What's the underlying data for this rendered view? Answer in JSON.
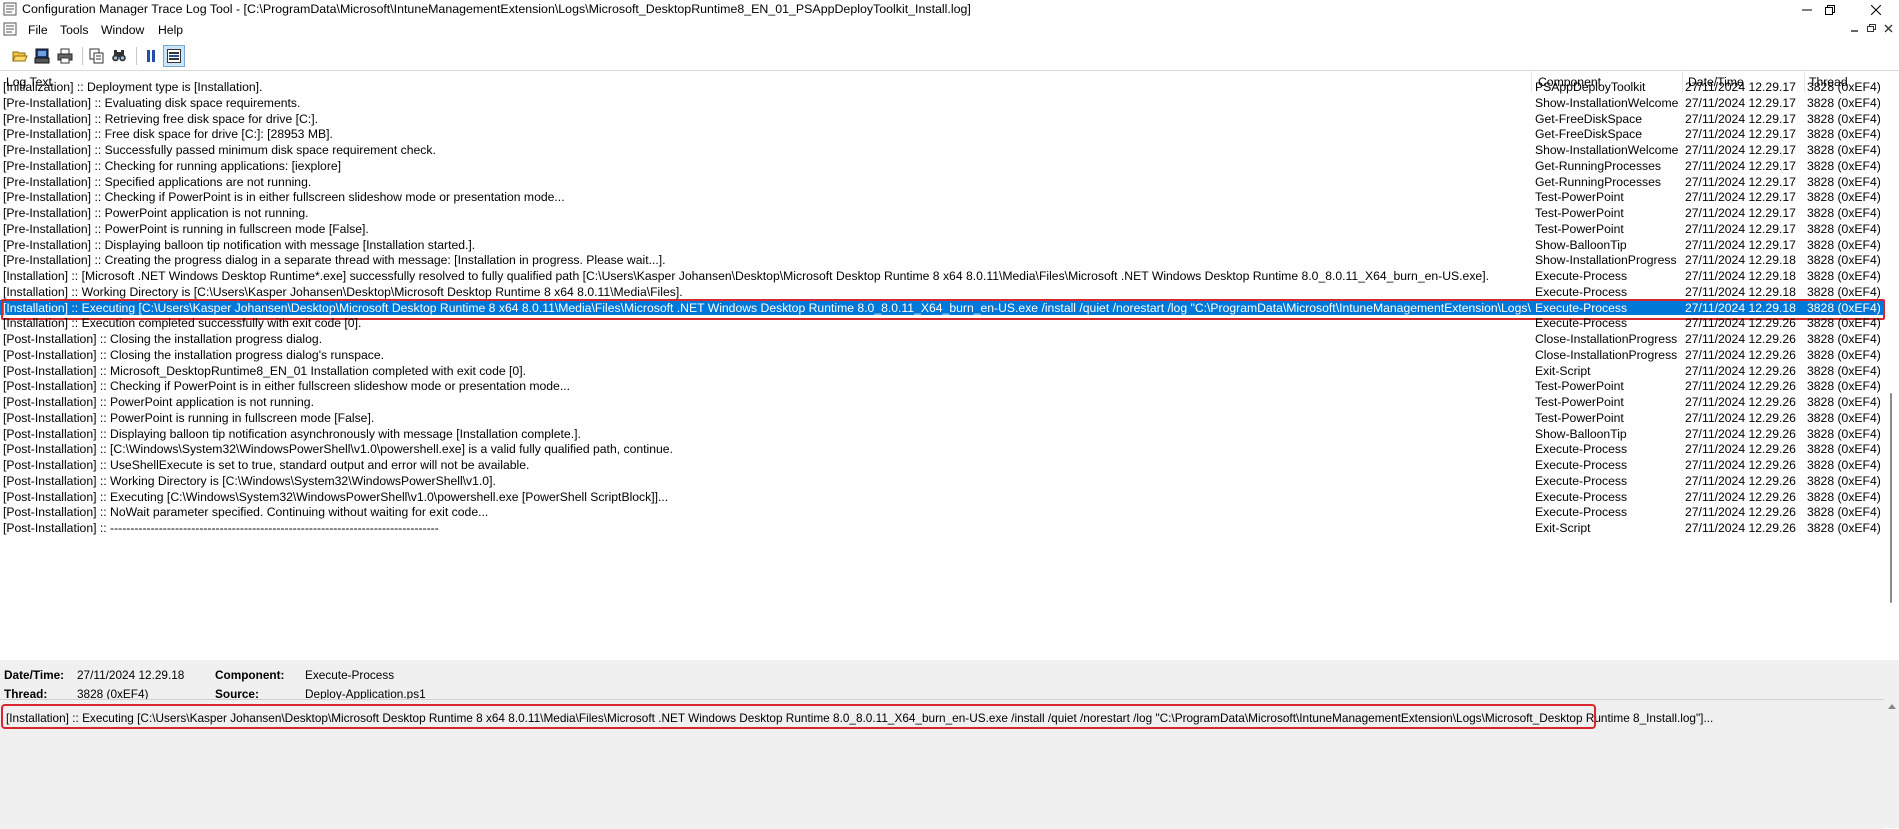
{
  "window": {
    "title": "Configuration Manager Trace Log Tool - [C:\\ProgramData\\Microsoft\\IntuneManagementExtension\\Logs\\Microsoft_DesktopRuntime8_EN_01_PSAppDeployToolkit_Install.log]"
  },
  "menu": {
    "items": [
      "File",
      "Tools",
      "Window",
      "Help"
    ]
  },
  "toolbar": {
    "buttons": [
      "open-icon",
      "print-preview-icon",
      "print-icon",
      "copy-icon",
      "find-icon",
      "pause-icon",
      "highlight-icon"
    ]
  },
  "log": {
    "headers": {
      "text": "Log Text",
      "component": "Component",
      "datetime": "Date/Time",
      "thread": "Thread"
    },
    "selected_index": 14,
    "selection_color": "#0078d7",
    "highlight_color": "#d8262e",
    "rows": [
      {
        "text": "[Initialization] :: Deployment type is [Installation].",
        "component": "PSAppDeployToolkit",
        "datetime": "27/11/2024 12.29.17",
        "thread": "3828 (0xEF4)"
      },
      {
        "text": "[Pre-Installation] :: Evaluating disk space requirements.",
        "component": "Show-InstallationWelcome",
        "datetime": "27/11/2024 12.29.17",
        "thread": "3828 (0xEF4)"
      },
      {
        "text": "[Pre-Installation] :: Retrieving free disk space for drive [C:].",
        "component": "Get-FreeDiskSpace",
        "datetime": "27/11/2024 12.29.17",
        "thread": "3828 (0xEF4)"
      },
      {
        "text": "[Pre-Installation] :: Free disk space for drive [C:]: [28953 MB].",
        "component": "Get-FreeDiskSpace",
        "datetime": "27/11/2024 12.29.17",
        "thread": "3828 (0xEF4)"
      },
      {
        "text": "[Pre-Installation] :: Successfully passed minimum disk space requirement check.",
        "component": "Show-InstallationWelcome",
        "datetime": "27/11/2024 12.29.17",
        "thread": "3828 (0xEF4)"
      },
      {
        "text": "[Pre-Installation] :: Checking for running applications: [iexplore]",
        "component": "Get-RunningProcesses",
        "datetime": "27/11/2024 12.29.17",
        "thread": "3828 (0xEF4)"
      },
      {
        "text": "[Pre-Installation] :: Specified applications are not running.",
        "component": "Get-RunningProcesses",
        "datetime": "27/11/2024 12.29.17",
        "thread": "3828 (0xEF4)"
      },
      {
        "text": "[Pre-Installation] :: Checking if PowerPoint is in either fullscreen slideshow mode or presentation mode...",
        "component": "Test-PowerPoint",
        "datetime": "27/11/2024 12.29.17",
        "thread": "3828 (0xEF4)"
      },
      {
        "text": "[Pre-Installation] :: PowerPoint application is not running.",
        "component": "Test-PowerPoint",
        "datetime": "27/11/2024 12.29.17",
        "thread": "3828 (0xEF4)"
      },
      {
        "text": "[Pre-Installation] :: PowerPoint is running in fullscreen mode [False].",
        "component": "Test-PowerPoint",
        "datetime": "27/11/2024 12.29.17",
        "thread": "3828 (0xEF4)"
      },
      {
        "text": "[Pre-Installation] :: Displaying balloon tip notification with message [Installation started.].",
        "component": "Show-BalloonTip",
        "datetime": "27/11/2024 12.29.17",
        "thread": "3828 (0xEF4)"
      },
      {
        "text": "[Pre-Installation] :: Creating the progress dialog in a separate thread with message: [Installation in progress. Please wait...].",
        "component": "Show-InstallationProgress",
        "datetime": "27/11/2024 12.29.18",
        "thread": "3828 (0xEF4)"
      },
      {
        "text": "[Installation] :: [Microsoft .NET Windows Desktop Runtime*.exe] successfully resolved to fully qualified path [C:\\Users\\Kasper Johansen\\Desktop\\Microsoft Desktop Runtime 8 x64 8.0.11\\Media\\Files\\Microsoft .NET Windows Desktop Runtime 8.0_8.0.11_X64_burn_en-US.exe].",
        "component": "Execute-Process",
        "datetime": "27/11/2024 12.29.18",
        "thread": "3828 (0xEF4)"
      },
      {
        "text": "[Installation] :: Working Directory is [C:\\Users\\Kasper Johansen\\Desktop\\Microsoft Desktop Runtime 8 x64 8.0.11\\Media\\Files].",
        "component": "Execute-Process",
        "datetime": "27/11/2024 12.29.18",
        "thread": "3828 (0xEF4)"
      },
      {
        "text": "[Installation] :: Executing [C:\\Users\\Kasper Johansen\\Desktop\\Microsoft Desktop Runtime 8 x64 8.0.11\\Media\\Files\\Microsoft .NET Windows Desktop Runtime 8.0_8.0.11_X64_burn_en-US.exe /install /quiet /norestart /log \"C:\\ProgramData\\Microsoft\\IntuneManagementExtension\\Logs\\Micr...",
        "component": "Execute-Process",
        "datetime": "27/11/2024 12.29.18",
        "thread": "3828 (0xEF4)"
      },
      {
        "text": "[Installation] :: Execution completed successfully with exit code [0].",
        "component": "Execute-Process",
        "datetime": "27/11/2024 12.29.26",
        "thread": "3828 (0xEF4)"
      },
      {
        "text": "[Post-Installation] :: Closing the installation progress dialog.",
        "component": "Close-InstallationProgress",
        "datetime": "27/11/2024 12.29.26",
        "thread": "3828 (0xEF4)"
      },
      {
        "text": "[Post-Installation] :: Closing the installation progress dialog's runspace.",
        "component": "Close-InstallationProgress",
        "datetime": "27/11/2024 12.29.26",
        "thread": "3828 (0xEF4)"
      },
      {
        "text": "[Post-Installation] :: Microsoft_DesktopRuntime8_EN_01 Installation completed with exit code [0].",
        "component": "Exit-Script",
        "datetime": "27/11/2024 12.29.26",
        "thread": "3828 (0xEF4)"
      },
      {
        "text": "[Post-Installation] :: Checking if PowerPoint is in either fullscreen slideshow mode or presentation mode...",
        "component": "Test-PowerPoint",
        "datetime": "27/11/2024 12.29.26",
        "thread": "3828 (0xEF4)"
      },
      {
        "text": "[Post-Installation] :: PowerPoint application is not running.",
        "component": "Test-PowerPoint",
        "datetime": "27/11/2024 12.29.26",
        "thread": "3828 (0xEF4)"
      },
      {
        "text": "[Post-Installation] :: PowerPoint is running in fullscreen mode [False].",
        "component": "Test-PowerPoint",
        "datetime": "27/11/2024 12.29.26",
        "thread": "3828 (0xEF4)"
      },
      {
        "text": "[Post-Installation] :: Displaying balloon tip notification asynchronously with message [Installation complete.].",
        "component": "Show-BalloonTip",
        "datetime": "27/11/2024 12.29.26",
        "thread": "3828 (0xEF4)"
      },
      {
        "text": "[Post-Installation] :: [C:\\Windows\\System32\\WindowsPowerShell\\v1.0\\powershell.exe] is a valid fully qualified path, continue.",
        "component": "Execute-Process",
        "datetime": "27/11/2024 12.29.26",
        "thread": "3828 (0xEF4)"
      },
      {
        "text": "[Post-Installation] :: UseShellExecute is set to true, standard output and error will not be available.",
        "component": "Execute-Process",
        "datetime": "27/11/2024 12.29.26",
        "thread": "3828 (0xEF4)"
      },
      {
        "text": "[Post-Installation] :: Working Directory is [C:\\Windows\\System32\\WindowsPowerShell\\v1.0].",
        "component": "Execute-Process",
        "datetime": "27/11/2024 12.29.26",
        "thread": "3828 (0xEF4)"
      },
      {
        "text": "[Post-Installation] :: Executing [C:\\Windows\\System32\\WindowsPowerShell\\v1.0\\powershell.exe [PowerShell ScriptBlock]]...",
        "component": "Execute-Process",
        "datetime": "27/11/2024 12.29.26",
        "thread": "3828 (0xEF4)"
      },
      {
        "text": "[Post-Installation] :: NoWait parameter specified. Continuing without waiting for exit code...",
        "component": "Execute-Process",
        "datetime": "27/11/2024 12.29.26",
        "thread": "3828 (0xEF4)"
      },
      {
        "text": "[Post-Installation] :: ---------------------------------------------------------------------------------",
        "component": "Exit-Script",
        "datetime": "27/11/2024 12.29.26",
        "thread": "3828 (0xEF4)"
      }
    ]
  },
  "details": {
    "datetime_label": "Date/Time:",
    "datetime_value": "27/11/2024 12.29.18",
    "component_label": "Component:",
    "component_value": "Execute-Process",
    "thread_label": "Thread:",
    "thread_value": "3828 (0xEF4)",
    "source_label": "Source:",
    "source_value": "Deploy-Application.ps1",
    "message": "[Installation] :: Executing [C:\\Users\\Kasper Johansen\\Desktop\\Microsoft Desktop Runtime 8 x64 8.0.11\\Media\\Files\\Microsoft .NET Windows Desktop Runtime 8.0_8.0.11_X64_burn_en-US.exe /install /quiet /norestart /log \"C:\\ProgramData\\Microsoft\\IntuneManagementExtension\\Logs\\Microsoft_Desktop Runtime 8_Install.log\"]..."
  }
}
